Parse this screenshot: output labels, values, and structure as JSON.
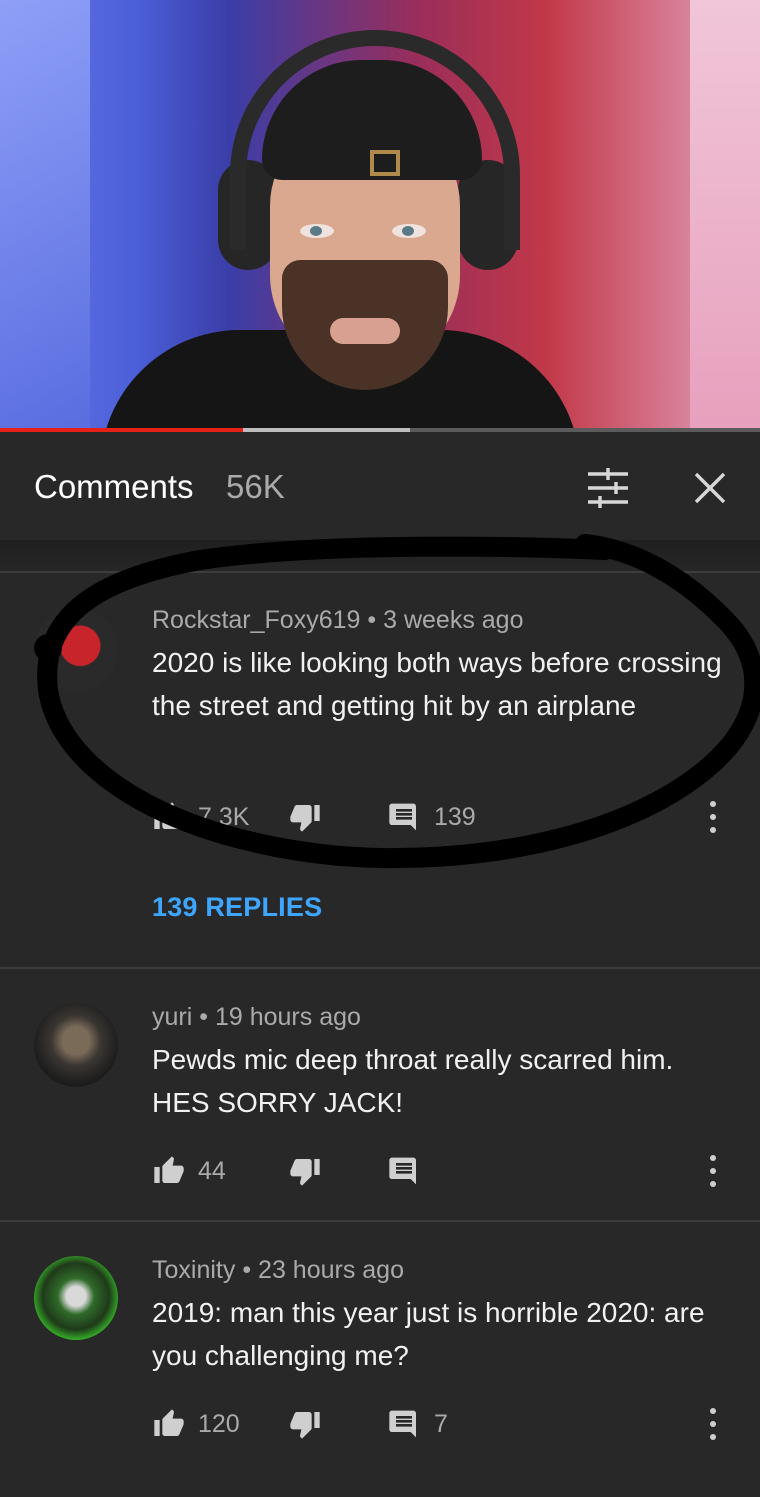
{
  "video": {
    "progress_played": 0.32,
    "progress_buffered": 0.54,
    "progress_color": "#e62117"
  },
  "header": {
    "title": "Comments",
    "count": "56K",
    "sort_icon": "sort-filter-icon",
    "close_icon": "close-icon"
  },
  "comments": [
    {
      "author": "Rockstar_Foxy619",
      "time": "3 weeks ago",
      "text": "2020 is like looking both ways before crossing the street and getting hit by an airplane",
      "likes": "7.3K",
      "reply_count": "139",
      "replies_link": "139 REPLIES"
    },
    {
      "author": "yuri",
      "time": "19 hours ago",
      "text": "Pewds mic deep throat really scarred him. HES SORRY JACK!",
      "likes": "44",
      "reply_count": ""
    },
    {
      "author": "Toxinity",
      "time": "23 hours ago",
      "text": "2019: man this year just is horrible  2020: are you challenging me?",
      "likes": "120",
      "reply_count": "7"
    }
  ],
  "separator": "•",
  "colors": {
    "background": "#282828",
    "accent_link": "#3ea6ff",
    "secondary_text": "#aaaaaa"
  }
}
